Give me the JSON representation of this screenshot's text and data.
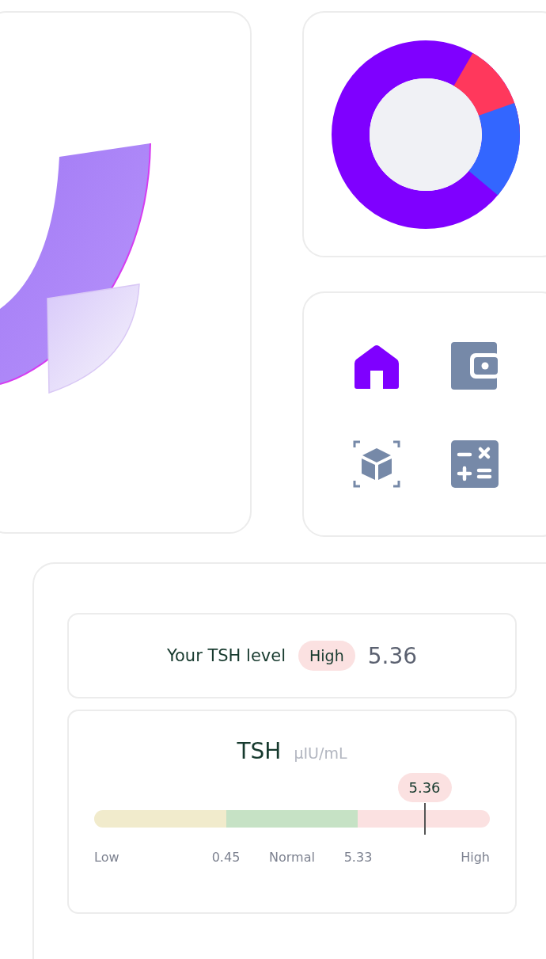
{
  "nav_icons": [
    {
      "kind": "home",
      "selected": true
    },
    {
      "kind": "wallet",
      "selected": false
    },
    {
      "kind": "cube",
      "selected": false
    },
    {
      "kind": "calculator",
      "selected": false
    }
  ],
  "tsh_summary": {
    "label": "Your TSH level",
    "status": "High",
    "value": "5.36"
  },
  "tsh_scale": {
    "title": "TSH",
    "unit": "µIU/mL",
    "marker_value": "5.36",
    "level": 0.835,
    "segments": [
      {
        "color": "#f1ebcc"
      },
      {
        "color": "#c6e2c5"
      },
      {
        "color": "#fbe1e1"
      }
    ],
    "labels": [
      "Low",
      "0.45",
      "Normal",
      "5.33",
      "High"
    ]
  }
}
